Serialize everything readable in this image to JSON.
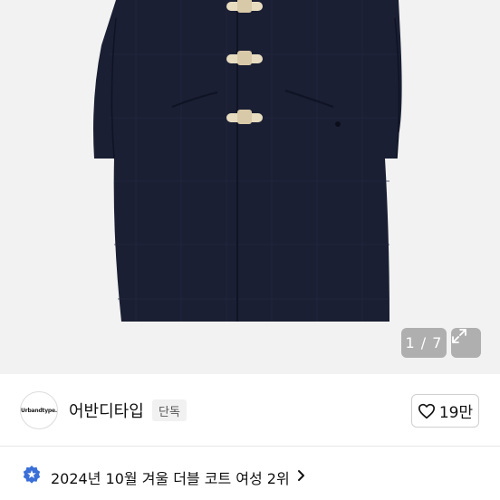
{
  "gallery": {
    "counter": "1 / 7",
    "image_alt": "navy check duffle coat",
    "coat_color": "#1a1f33",
    "toggle_color": "#e8dcc0"
  },
  "seller": {
    "logo_text": "Urbandtype.",
    "name": "어반디타입",
    "badge": "단독"
  },
  "like": {
    "count": "19만"
  },
  "ranking": {
    "text": "2024년 10월 겨울 더블 코트 여성 2위",
    "icon_color": "#3a6fd8"
  }
}
